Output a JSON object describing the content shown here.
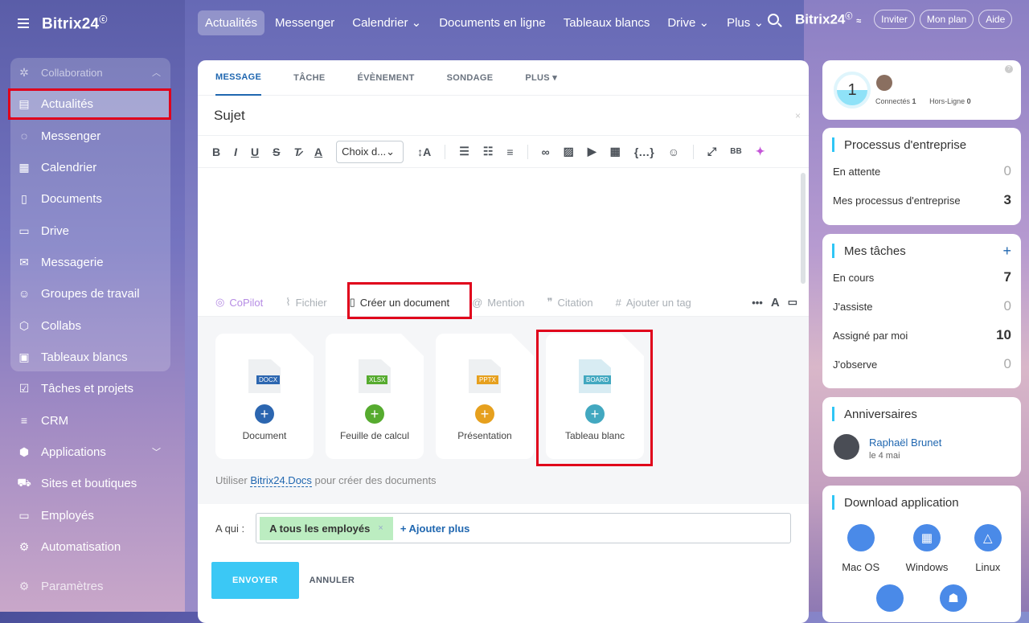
{
  "brand": {
    "name": "Bitrix24",
    "mark": "ⓒ"
  },
  "nav": [
    "Actualités",
    "Messenger",
    "Calendrier ⌄",
    "Documents en ligne",
    "Tableaux blancs",
    "Drive ⌄",
    "Plus ⌄"
  ],
  "top_right": {
    "brand": "Bitrix24",
    "invite": "Inviter",
    "plan": "Mon plan",
    "help": "Aide"
  },
  "sidebar": {
    "group": "Collaboration",
    "items": [
      "Actualités",
      "Messenger",
      "Calendrier",
      "Documents",
      "Drive",
      "Messagerie",
      "Groupes de travail",
      "Collabs",
      "Tableaux blancs",
      "Tâches et projets",
      "CRM",
      "Applications",
      "Sites et boutiques",
      "Employés",
      "Automatisation",
      "Paramètres"
    ]
  },
  "post": {
    "tabs": [
      "MESSAGE",
      "TÂCHE",
      "ÉVÈNEMENT",
      "SONDAGE",
      "PLUS ▾"
    ],
    "subject_placeholder": "Sujet",
    "font_select": "Choix d...⌄",
    "attachments": {
      "copilot": "CoPilot",
      "file": "Fichier",
      "create": "Créer un document",
      "mention": "Mention",
      "quote": "Citation",
      "tag": "Ajouter un tag"
    },
    "docs": [
      {
        "ext": "DOCX",
        "label": "Document",
        "color": "#2c66b0"
      },
      {
        "ext": "XLSX",
        "label": "Feuille de calcul",
        "color": "#56ab2f"
      },
      {
        "ext": "PPTX",
        "label": "Présentation",
        "color": "#e6a01e"
      },
      {
        "ext": "BOARD",
        "label": "Tableau blanc",
        "color": "#42a8c0"
      }
    ],
    "docs_note_prefix": "Utiliser ",
    "docs_note_link": "Bitrix24.Docs",
    "docs_note_suffix": " pour créer des documents",
    "to_label": "A qui :",
    "recipient": "A tous les employés",
    "add_more": "+ Ajouter plus",
    "send": "ENVOYER",
    "cancel": "ANNULER"
  },
  "widgets": {
    "online": {
      "count": "1",
      "connected": "Connectés",
      "connected_n": "1",
      "offline": "Hors-Ligne",
      "offline_n": "0"
    },
    "process": {
      "title": "Processus d'entreprise",
      "rows": [
        {
          "label": "En attente",
          "value": "0"
        },
        {
          "label": "Mes processus d'entreprise",
          "value": "3"
        }
      ]
    },
    "tasks": {
      "title": "Mes tâches",
      "rows": [
        {
          "label": "En cours",
          "value": "7"
        },
        {
          "label": "J'assiste",
          "value": "0"
        },
        {
          "label": "Assigné par moi",
          "value": "10"
        },
        {
          "label": "J'observe",
          "value": "0"
        }
      ]
    },
    "birthdays": {
      "title": "Anniversaires",
      "name": "Raphaël Brunet",
      "date": "le 4 mai"
    },
    "download": {
      "title": "Download application",
      "apps": [
        "Mac OS",
        "Windows",
        "Linux"
      ]
    }
  }
}
